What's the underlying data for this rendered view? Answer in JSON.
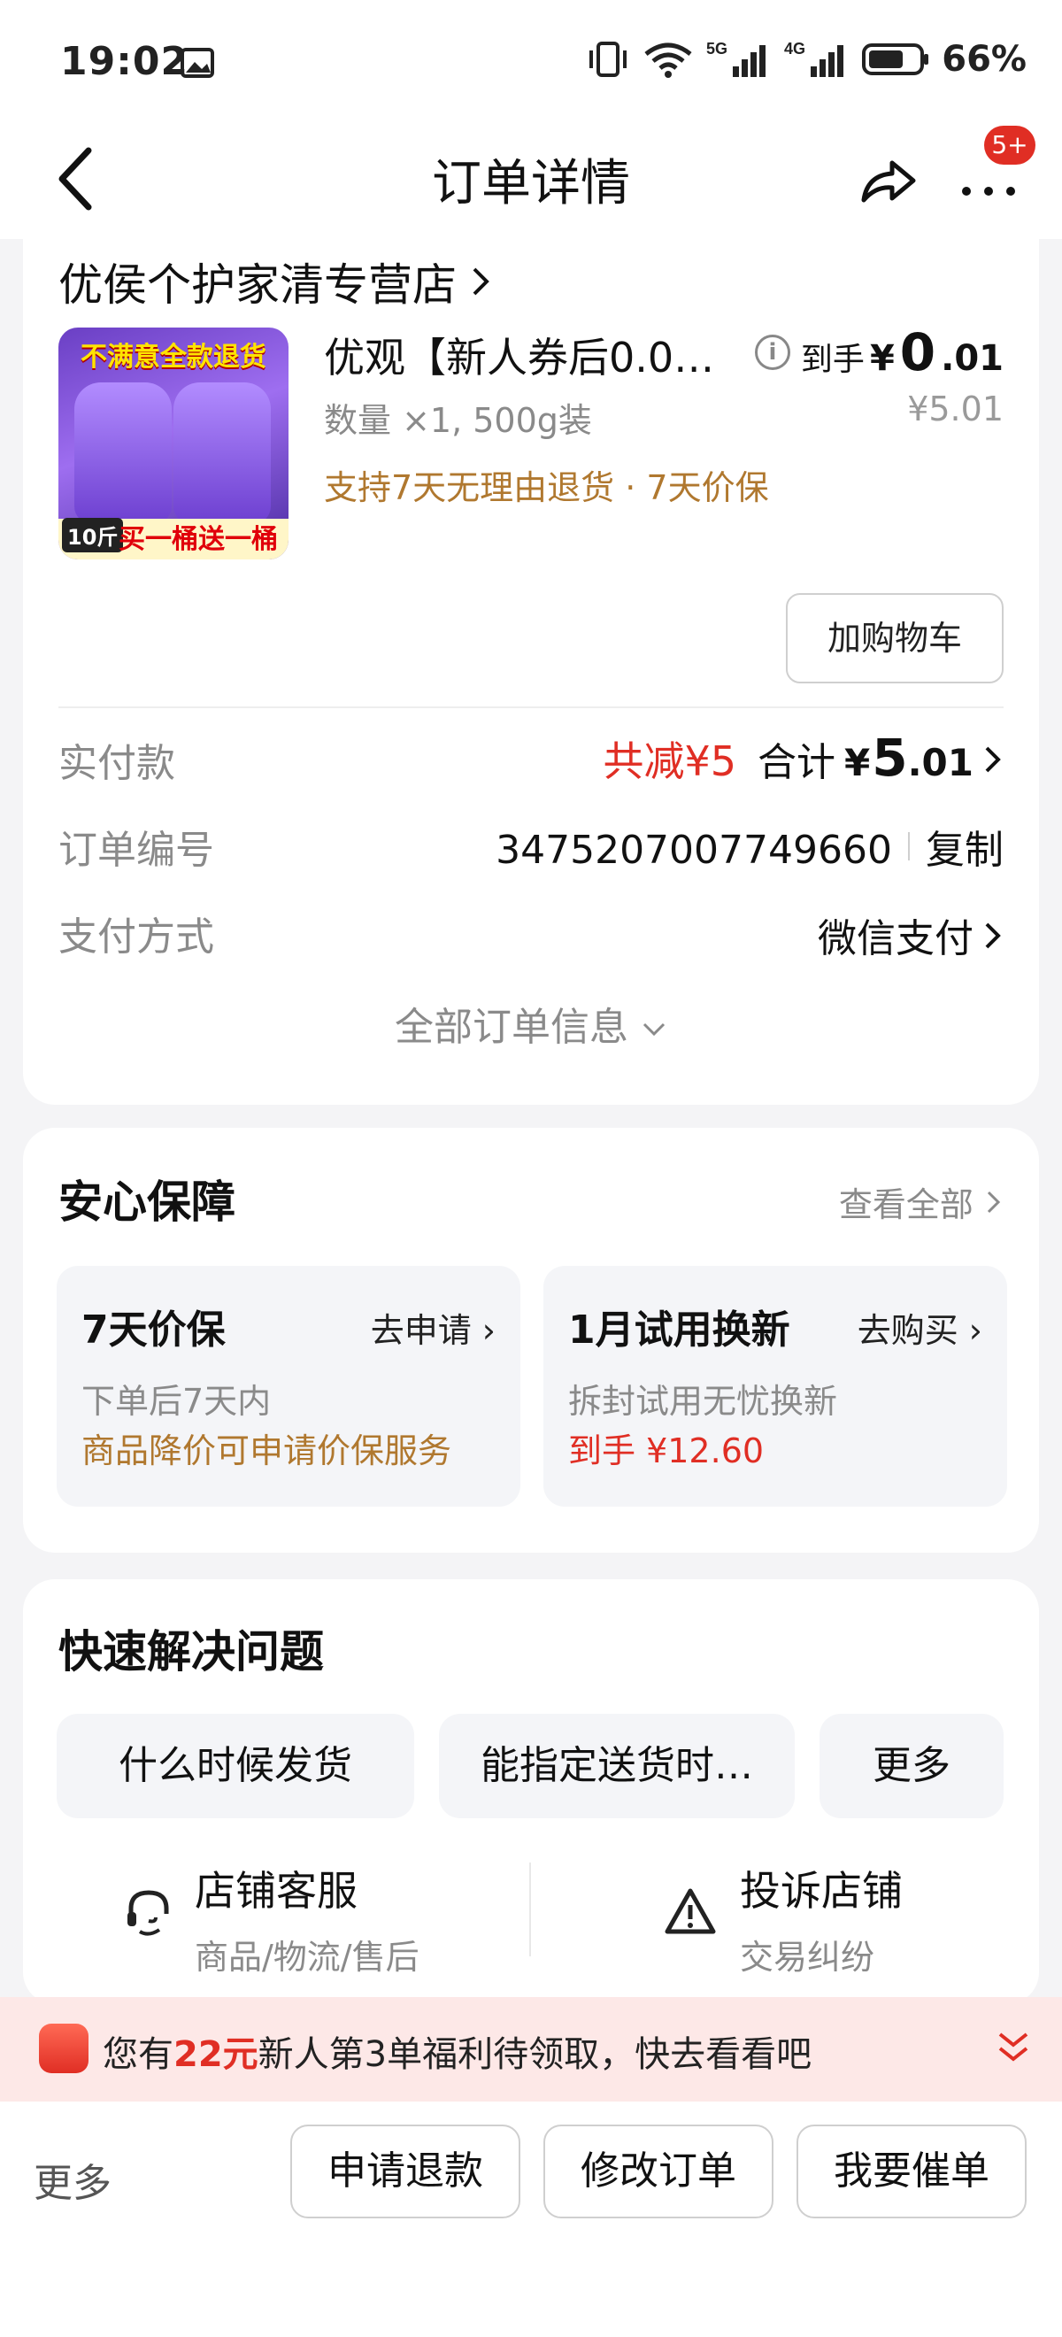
{
  "status_bar": {
    "time": "19:02",
    "network": "5G 4G",
    "battery": "66%"
  },
  "nav": {
    "title": "订单详情",
    "badge": "5+"
  },
  "store": {
    "name": "优侯个护家清专营店"
  },
  "product": {
    "image_top_text": "不满意全款退货",
    "image_weight": "10斤",
    "image_promo": "买一桶送一桶",
    "name": "优观【新人券后0.01…",
    "qty": "数量 ×1, 500g装",
    "support": "支持7天无理由退货 · 7天价保",
    "price_label": "到手",
    "price_symbol": "¥",
    "price_int": "0",
    "price_dec": ".01",
    "original_price": "¥5.01",
    "add_cart": "加购物车"
  },
  "summary": {
    "paid_label": "实付款",
    "discount": "共减¥5",
    "total_label": "合计",
    "total_symbol": "¥",
    "total_int": "5",
    "total_dec": ".01",
    "order_no_label": "订单编号",
    "order_no": "3475207007749660",
    "copy": "复制",
    "pay_label": "支付方式",
    "pay_value": "微信支付",
    "all_info": "全部订单信息"
  },
  "guarantee": {
    "title": "安心保障",
    "see_all": "查看全部",
    "cards": [
      {
        "title": "7天价保",
        "action": "去申请",
        "line1": "下单后7天内",
        "line2": "商品降价可申请价保服务"
      },
      {
        "title": "1月试用换新",
        "action": "去购买",
        "line1": "拆封试用无忧换新",
        "line2": "到手 ¥12.60"
      }
    ]
  },
  "quick": {
    "title": "快速解决问题",
    "questions": [
      "什么时候发货",
      "能指定送货时…",
      "更多"
    ],
    "service": {
      "name": "店铺客服",
      "desc": "商品/物流/售后"
    },
    "complaint": {
      "name": "投诉店铺",
      "desc": "交易纠纷"
    }
  },
  "banner": {
    "prefix": "您有",
    "amount": "22元",
    "suffix": "新人第3单福利待领取，快去看看吧"
  },
  "bottom": {
    "more": "更多",
    "buttons": [
      "申请退款",
      "修改订单",
      "我要催单"
    ]
  },
  "colors": {
    "accent_red": "#e02e24",
    "support_brown": "#b0782f",
    "background": "#f4f4f6"
  }
}
